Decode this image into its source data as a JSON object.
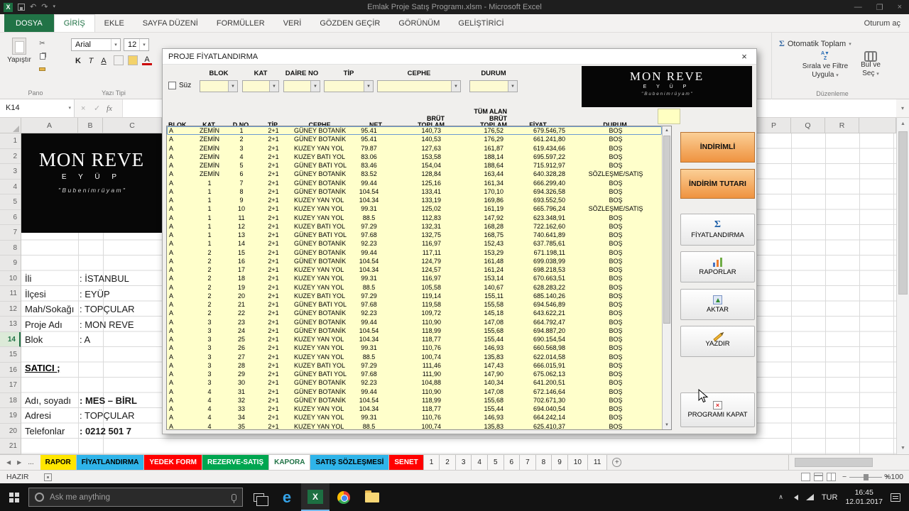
{
  "window": {
    "title": "Emlak Proje Satış Programı.xlsm - Microsoft Excel",
    "minimize": "—",
    "maximize": "❐",
    "close": "×",
    "signin": "Oturum aç"
  },
  "brand": {
    "line1": "MON REVE",
    "line2": "E Y Ü P",
    "tagline": "\" B u   b e n i m   r ü y a m \""
  },
  "ribbon": {
    "tabs": [
      {
        "label": "DOSYA",
        "cls": "rt-file"
      },
      {
        "label": "GİRİŞ",
        "cls": "rt-active"
      },
      {
        "label": "EKLE",
        "cls": ""
      },
      {
        "label": "SAYFA DÜZENİ",
        "cls": ""
      },
      {
        "label": "FORMÜLLER",
        "cls": ""
      },
      {
        "label": "VERİ",
        "cls": ""
      },
      {
        "label": "GÖZDEN GEÇİR",
        "cls": ""
      },
      {
        "label": "GÖRÜNÜM",
        "cls": ""
      },
      {
        "label": "GELİŞTİRİCİ",
        "cls": ""
      }
    ],
    "paste": "Yapıştır",
    "pano": "Pano",
    "font_group": "Yazı Tipi",
    "font_name": "Arial",
    "font_size": "12",
    "bold": "K",
    "italic": "T",
    "underline": "A",
    "autosum": "Otomatik Toplam",
    "sort1": "Sırala ve Filtre",
    "sort2": "Uygula",
    "find1": "Bul ve",
    "find2": "Seç",
    "editing_group": "Düzenleme"
  },
  "formula_bar": {
    "name_box": "K14",
    "fx": "fx"
  },
  "worksheet": {
    "row_numbers": [
      "1",
      "2",
      "3",
      "4",
      "5",
      "6",
      "7",
      "8",
      "9",
      "10",
      "11",
      "12",
      "13",
      "14",
      "15",
      "16",
      "17",
      "18",
      "19",
      "20",
      "21"
    ],
    "cols_left": [
      "A",
      "B",
      "C"
    ],
    "cols_right": [
      "P",
      "Q",
      "R"
    ],
    "fields": [
      {
        "label": "İli",
        "value": ":  İSTANBUL"
      },
      {
        "label": "İlçesi",
        "value": ":  EYÜP"
      },
      {
        "label": "Mah/Sokağı",
        "value": ":  TOPÇULAR"
      },
      {
        "label": "Proje  Adı",
        "value": ":  MON REVE"
      },
      {
        "label": "Blok",
        "value": ":  A"
      }
    ],
    "seller_heading": "SATICI ;",
    "seller": [
      {
        "label": "Adı, soyadı",
        "value": ": MES – BİRL"
      },
      {
        "label": "Adresi",
        "value": ": TOPÇULAR"
      },
      {
        "label": "Telefonlar",
        "value": ": 0212 501 7"
      }
    ]
  },
  "dialog": {
    "title": "PROJE FİYATLANDIRMA",
    "close": "×",
    "suz": "Süz",
    "filters": [
      "BLOK",
      "KAT",
      "DAİRE NO",
      "TİP",
      "CEPHE",
      "DURUM"
    ],
    "headers": [
      "BLOK",
      "KAT",
      "D.NO",
      "TİP",
      "CEPHE",
      "NET",
      "BRÜT TOPLAM",
      "TÜM ALAN BRÜT TOPLAM",
      "FİYAT",
      "DURUM"
    ],
    "rows": [
      [
        "A",
        "ZEMİN",
        "1",
        "2+1",
        "GÜNEY BOTANİK",
        "95.41",
        "140,73",
        "176,52",
        "679.546,75",
        "BOŞ"
      ],
      [
        "A",
        "ZEMİN",
        "2",
        "2+1",
        "GÜNEY BOTANİK",
        "95.41",
        "140,53",
        "176,29",
        "661.241,80",
        "BOŞ"
      ],
      [
        "A",
        "ZEMİN",
        "3",
        "2+1",
        "KUZEY YAN YOL",
        "79.87",
        "127,63",
        "161,87",
        "619.434,66",
        "BOŞ"
      ],
      [
        "A",
        "ZEMİN",
        "4",
        "2+1",
        "KUZEY BATI YOL",
        "83.06",
        "153,58",
        "188,14",
        "695.597,22",
        "BOŞ"
      ],
      [
        "A",
        "ZEMİN",
        "5",
        "2+1",
        "GÜNEY BATI YOL",
        "83.46",
        "154,04",
        "188,64",
        "715.912,97",
        "BOŞ"
      ],
      [
        "A",
        "ZEMİN",
        "6",
        "2+1",
        "GÜNEY BOTANİK",
        "83.52",
        "128,84",
        "163,44",
        "640.328,28",
        "SÖZLEŞME/SATIŞ"
      ],
      [
        "A",
        "1",
        "7",
        "2+1",
        "GÜNEY BOTANİK",
        "99.44",
        "125,16",
        "161,34",
        "666.299,40",
        "BOŞ"
      ],
      [
        "A",
        "1",
        "8",
        "2+1",
        "GÜNEY BOTANİK",
        "104.54",
        "133,41",
        "170,10",
        "694.326,58",
        "BOŞ"
      ],
      [
        "A",
        "1",
        "9",
        "2+1",
        "KUZEY YAN YOL",
        "104.34",
        "133,19",
        "169,86",
        "693.552,50",
        "BOŞ"
      ],
      [
        "A",
        "1",
        "10",
        "2+1",
        "KUZEY YAN YOL",
        "99.31",
        "125,02",
        "161,19",
        "665.796,24",
        "SÖZLEŞME/SATIŞ"
      ],
      [
        "A",
        "1",
        "11",
        "2+1",
        "KUZEY YAN YOL",
        "88.5",
        "112,83",
        "147,92",
        "623.348,91",
        "BOŞ"
      ],
      [
        "A",
        "1",
        "12",
        "2+1",
        "KUZEY BATI YOL",
        "97.29",
        "132,31",
        "168,28",
        "722.162,60",
        "BOŞ"
      ],
      [
        "A",
        "1",
        "13",
        "2+1",
        "GÜNEY BATI YOL",
        "97.68",
        "132,75",
        "168,75",
        "740.641,89",
        "BOŞ"
      ],
      [
        "A",
        "1",
        "14",
        "2+1",
        "GÜNEY BOTANİK",
        "92.23",
        "116,97",
        "152,43",
        "637.785,61",
        "BOŞ"
      ],
      [
        "A",
        "2",
        "15",
        "2+1",
        "GÜNEY BOTANİK",
        "99.44",
        "117,11",
        "153,29",
        "671.198,11",
        "BOŞ"
      ],
      [
        "A",
        "2",
        "16",
        "2+1",
        "GÜNEY BOTANİK",
        "104.54",
        "124,79",
        "161,48",
        "699.038,99",
        "BOŞ"
      ],
      [
        "A",
        "2",
        "17",
        "2+1",
        "KUZEY YAN YOL",
        "104.34",
        "124,57",
        "161,24",
        "698.218,53",
        "BOŞ"
      ],
      [
        "A",
        "2",
        "18",
        "2+1",
        "KUZEY YAN YOL",
        "99.31",
        "116,97",
        "153,14",
        "670.663,51",
        "BOŞ"
      ],
      [
        "A",
        "2",
        "19",
        "2+1",
        "KUZEY YAN YOL",
        "88.5",
        "105,58",
        "140,67",
        "628.283,22",
        "BOŞ"
      ],
      [
        "A",
        "2",
        "20",
        "2+1",
        "KUZEY BATI YOL",
        "97.29",
        "119,14",
        "155,11",
        "685.140,26",
        "BOŞ"
      ],
      [
        "A",
        "2",
        "21",
        "2+1",
        "GÜNEY BATI YOL",
        "97.68",
        "119,58",
        "155,58",
        "694.546,89",
        "BOŞ"
      ],
      [
        "A",
        "2",
        "22",
        "2+1",
        "GÜNEY BOTANİK",
        "92.23",
        "109,72",
        "145,18",
        "643.622,21",
        "BOŞ"
      ],
      [
        "A",
        "3",
        "23",
        "2+1",
        "GÜNEY BOTANİK",
        "99.44",
        "110,90",
        "147,08",
        "664.792,47",
        "BOŞ"
      ],
      [
        "A",
        "3",
        "24",
        "2+1",
        "GÜNEY BOTANİK",
        "104.54",
        "118,99",
        "155,68",
        "694.887,20",
        "BOŞ"
      ],
      [
        "A",
        "3",
        "25",
        "2+1",
        "KUZEY YAN YOL",
        "104.34",
        "118,77",
        "155,44",
        "690.154,54",
        "BOŞ"
      ],
      [
        "A",
        "3",
        "26",
        "2+1",
        "KUZEY YAN YOL",
        "99.31",
        "110,76",
        "146,93",
        "660.568,98",
        "BOŞ"
      ],
      [
        "A",
        "3",
        "27",
        "2+1",
        "KUZEY YAN YOL",
        "88.5",
        "100,74",
        "135,83",
        "622.014,58",
        "BOŞ"
      ],
      [
        "A",
        "3",
        "28",
        "2+1",
        "KUZEY BATI YOL",
        "97.29",
        "111,46",
        "147,43",
        "666.015,91",
        "BOŞ"
      ],
      [
        "A",
        "3",
        "29",
        "2+1",
        "GÜNEY BATI YOL",
        "97.68",
        "111,90",
        "147,90",
        "675.062,13",
        "BOŞ"
      ],
      [
        "A",
        "3",
        "30",
        "2+1",
        "GÜNEY BOTANİK",
        "92.23",
        "104,88",
        "140,34",
        "641.200,51",
        "BOŞ"
      ],
      [
        "A",
        "4",
        "31",
        "2+1",
        "GÜNEY BOTANİK",
        "99.44",
        "110,90",
        "147,08",
        "672.146,64",
        "BOŞ"
      ],
      [
        "A",
        "4",
        "32",
        "2+1",
        "GÜNEY BOTANİK",
        "104.54",
        "118,99",
        "155,68",
        "702.671,30",
        "BOŞ"
      ],
      [
        "A",
        "4",
        "33",
        "2+1",
        "KUZEY YAN YOL",
        "104.34",
        "118,77",
        "155,44",
        "694.040,54",
        "BOŞ"
      ],
      [
        "A",
        "4",
        "34",
        "2+1",
        "KUZEY YAN YOL",
        "99.31",
        "110,76",
        "146,93",
        "664.242,14",
        "BOŞ"
      ],
      [
        "A",
        "4",
        "35",
        "2+1",
        "KUZEY YAN YOL",
        "88.5",
        "100,74",
        "135,83",
        "625.410,37",
        "BOŞ"
      ]
    ],
    "buttons": {
      "indirimli": "İNDİRİMLİ",
      "indirim_tutari": "İNDİRİM TUTARI",
      "fiyatlandirma": "FİYATLANDIRMA",
      "raporlar": "RAPORLAR",
      "aktar": "AKTAR",
      "yazdir": "YAZDIR",
      "kapat": "PROGRAMI KAPAT"
    }
  },
  "tab_bar": {
    "prev": "◀",
    "next": "▶",
    "more": "...",
    "add": "+"
  },
  "sheet_tabs": [
    {
      "label": "RAPOR",
      "cls": "t-yellow"
    },
    {
      "label": "FİYATLANDIRMA",
      "cls": "t-cyan"
    },
    {
      "label": "YEDEK FORM",
      "cls": "t-red"
    },
    {
      "label": "REZERVE-SATIŞ",
      "cls": "t-green"
    },
    {
      "label": "KAPORA",
      "cls": "t-active"
    },
    {
      "label": "SATIŞ SÖZLEŞMESİ",
      "cls": "t-cyan"
    },
    {
      "label": "SENET",
      "cls": "t-red"
    },
    {
      "label": "1",
      "cls": "t-num"
    },
    {
      "label": "2",
      "cls": "t-num"
    },
    {
      "label": "3",
      "cls": "t-num"
    },
    {
      "label": "4",
      "cls": "t-num"
    },
    {
      "label": "5",
      "cls": "t-num"
    },
    {
      "label": "6",
      "cls": "t-num"
    },
    {
      "label": "7",
      "cls": "t-num"
    },
    {
      "label": "8",
      "cls": "t-num"
    },
    {
      "label": "9",
      "cls": "t-num"
    },
    {
      "label": "10",
      "cls": "t-num"
    },
    {
      "label": "11",
      "cls": "t-num"
    }
  ],
  "status": {
    "ready": "HAZIR",
    "zoom": "%100"
  },
  "taskbar": {
    "search": "Ask me anything",
    "lang": "TUR",
    "time": "16:45",
    "date": "12.01.2017"
  }
}
